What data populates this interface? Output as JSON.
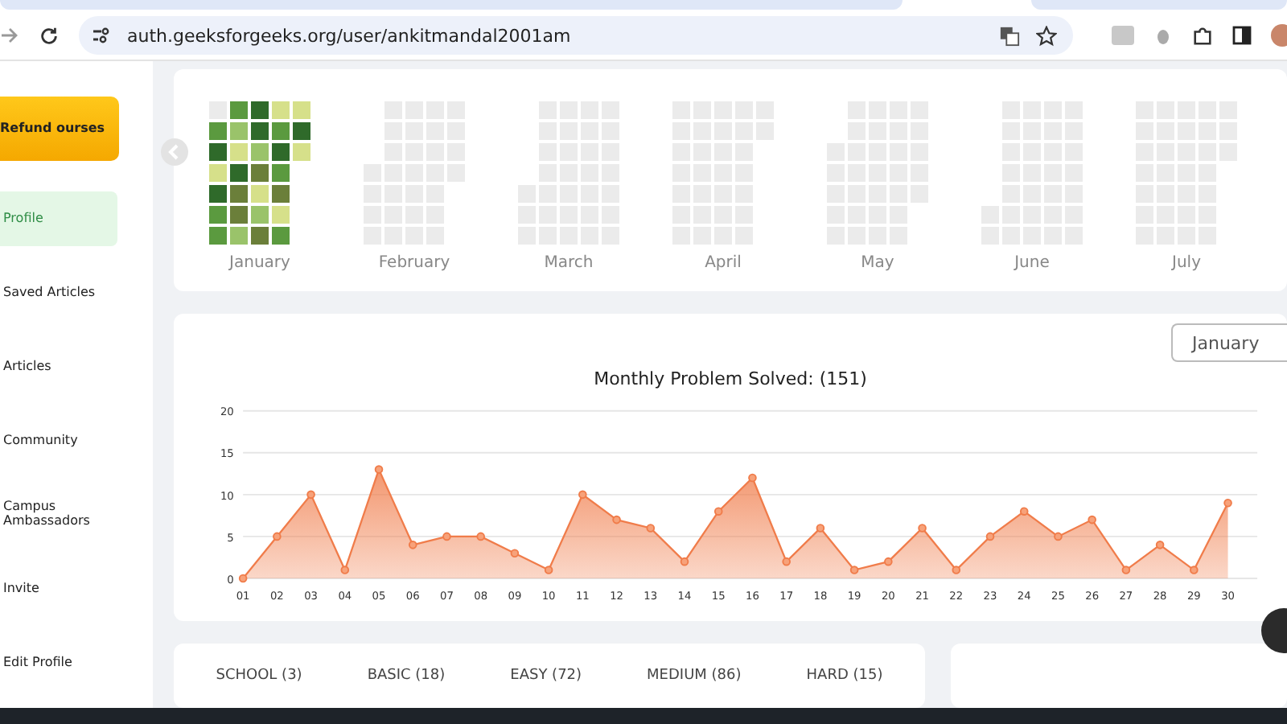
{
  "browser": {
    "url": "auth.geeksforgeeks.org/user/ankitmandal2001am"
  },
  "sidebar": {
    "promo": "Refund ourses",
    "items": [
      {
        "label": "Profile",
        "selected": true
      },
      {
        "label": "Saved Articles",
        "selected": false
      },
      {
        "label": "Articles",
        "selected": false
      },
      {
        "label": "Community",
        "selected": false
      },
      {
        "label": "Campus Ambassadors",
        "selected": false
      },
      {
        "label": "Invite",
        "selected": false
      },
      {
        "label": "Edit Profile",
        "selected": false
      }
    ]
  },
  "heatmap": {
    "months": [
      {
        "name": "January",
        "rows": [
          [
            {
              "color": "#ebebeb"
            },
            {
              "color": "#5b9a3f"
            },
            {
              "color": "#2f6a2a"
            },
            {
              "color": "#d6e08a"
            },
            {
              "color": "#d6e08a"
            }
          ],
          [
            {
              "color": "#5b9a3f"
            },
            {
              "color": "#9ac36a"
            },
            {
              "color": "#2f6a2a"
            },
            {
              "color": "#5b9a3f"
            },
            {
              "color": "#2f6a2a"
            }
          ],
          [
            {
              "color": "#2f6a2a"
            },
            {
              "color": "#d6e08a"
            },
            {
              "color": "#9ac36a"
            },
            {
              "color": "#2f6a2a"
            },
            {
              "color": "#d6e08a"
            }
          ],
          [
            {
              "color": "#d6e08a"
            },
            {
              "color": "#2f6a2a"
            },
            {
              "color": "#6b7f3a"
            },
            {
              "color": "#5b9a3f"
            },
            null
          ],
          [
            {
              "color": "#2f6a2a"
            },
            {
              "color": "#6b7f3a"
            },
            {
              "color": "#d6e08a"
            },
            {
              "color": "#6b7f3a"
            },
            null
          ],
          [
            {
              "color": "#5b9a3f"
            },
            {
              "color": "#6b7f3a"
            },
            {
              "color": "#9ac36a"
            },
            {
              "color": "#d6e08a"
            },
            null
          ],
          [
            {
              "color": "#5b9a3f"
            },
            {
              "color": "#9ac36a"
            },
            {
              "color": "#6b7f3a"
            },
            {
              "color": "#5b9a3f"
            },
            null
          ]
        ]
      },
      {
        "name": "February",
        "rows": [
          [
            null,
            {
              "color": "#ebebeb"
            },
            {
              "color": "#ebebeb"
            },
            {
              "color": "#ebebeb"
            },
            {
              "color": "#ebebeb"
            }
          ],
          [
            null,
            {
              "color": "#ebebeb"
            },
            {
              "color": "#ebebeb"
            },
            {
              "color": "#ebebeb"
            },
            {
              "color": "#ebebeb"
            }
          ],
          [
            null,
            {
              "color": "#ebebeb"
            },
            {
              "color": "#ebebeb"
            },
            {
              "color": "#ebebeb"
            },
            {
              "color": "#ebebeb"
            }
          ],
          [
            {
              "color": "#ebebeb"
            },
            {
              "color": "#ebebeb"
            },
            {
              "color": "#ebebeb"
            },
            {
              "color": "#ebebeb"
            },
            {
              "color": "#ebebeb"
            }
          ],
          [
            {
              "color": "#ebebeb"
            },
            {
              "color": "#ebebeb"
            },
            {
              "color": "#ebebeb"
            },
            {
              "color": "#ebebeb"
            },
            null
          ],
          [
            {
              "color": "#ebebeb"
            },
            {
              "color": "#ebebeb"
            },
            {
              "color": "#ebebeb"
            },
            {
              "color": "#ebebeb"
            },
            null
          ],
          [
            {
              "color": "#ebebeb"
            },
            {
              "color": "#ebebeb"
            },
            {
              "color": "#ebebeb"
            },
            {
              "color": "#ebebeb"
            },
            null
          ]
        ]
      },
      {
        "name": "March",
        "rows": [
          [
            null,
            {
              "color": "#ebebeb"
            },
            {
              "color": "#ebebeb"
            },
            {
              "color": "#ebebeb"
            },
            {
              "color": "#ebebeb"
            }
          ],
          [
            null,
            {
              "color": "#ebebeb"
            },
            {
              "color": "#ebebeb"
            },
            {
              "color": "#ebebeb"
            },
            {
              "color": "#ebebeb"
            }
          ],
          [
            null,
            {
              "color": "#ebebeb"
            },
            {
              "color": "#ebebeb"
            },
            {
              "color": "#ebebeb"
            },
            {
              "color": "#ebebeb"
            }
          ],
          [
            null,
            {
              "color": "#ebebeb"
            },
            {
              "color": "#ebebeb"
            },
            {
              "color": "#ebebeb"
            },
            {
              "color": "#ebebeb"
            }
          ],
          [
            {
              "color": "#ebebeb"
            },
            {
              "color": "#ebebeb"
            },
            {
              "color": "#ebebeb"
            },
            {
              "color": "#ebebeb"
            },
            {
              "color": "#ebebeb"
            }
          ],
          [
            {
              "color": "#ebebeb"
            },
            {
              "color": "#ebebeb"
            },
            {
              "color": "#ebebeb"
            },
            {
              "color": "#ebebeb"
            },
            {
              "color": "#ebebeb"
            }
          ],
          [
            {
              "color": "#ebebeb"
            },
            {
              "color": "#ebebeb"
            },
            {
              "color": "#ebebeb"
            },
            {
              "color": "#ebebeb"
            },
            {
              "color": "#ebebeb"
            }
          ]
        ]
      },
      {
        "name": "April",
        "rows": [
          [
            {
              "color": "#ebebeb"
            },
            {
              "color": "#ebebeb"
            },
            {
              "color": "#ebebeb"
            },
            {
              "color": "#ebebeb"
            },
            {
              "color": "#ebebeb"
            }
          ],
          [
            {
              "color": "#ebebeb"
            },
            {
              "color": "#ebebeb"
            },
            {
              "color": "#ebebeb"
            },
            {
              "color": "#ebebeb"
            },
            {
              "color": "#ebebeb"
            }
          ],
          [
            {
              "color": "#ebebeb"
            },
            {
              "color": "#ebebeb"
            },
            {
              "color": "#ebebeb"
            },
            {
              "color": "#ebebeb"
            },
            null
          ],
          [
            {
              "color": "#ebebeb"
            },
            {
              "color": "#ebebeb"
            },
            {
              "color": "#ebebeb"
            },
            {
              "color": "#ebebeb"
            },
            null
          ],
          [
            {
              "color": "#ebebeb"
            },
            {
              "color": "#ebebeb"
            },
            {
              "color": "#ebebeb"
            },
            {
              "color": "#ebebeb"
            },
            null
          ],
          [
            {
              "color": "#ebebeb"
            },
            {
              "color": "#ebebeb"
            },
            {
              "color": "#ebebeb"
            },
            {
              "color": "#ebebeb"
            },
            null
          ],
          [
            {
              "color": "#ebebeb"
            },
            {
              "color": "#ebebeb"
            },
            {
              "color": "#ebebeb"
            },
            {
              "color": "#ebebeb"
            },
            null
          ]
        ]
      },
      {
        "name": "May",
        "rows": [
          [
            null,
            {
              "color": "#ebebeb"
            },
            {
              "color": "#ebebeb"
            },
            {
              "color": "#ebebeb"
            },
            {
              "color": "#ebebeb"
            }
          ],
          [
            null,
            {
              "color": "#ebebeb"
            },
            {
              "color": "#ebebeb"
            },
            {
              "color": "#ebebeb"
            },
            {
              "color": "#ebebeb"
            }
          ],
          [
            {
              "color": "#ebebeb"
            },
            {
              "color": "#ebebeb"
            },
            {
              "color": "#ebebeb"
            },
            {
              "color": "#ebebeb"
            },
            {
              "color": "#ebebeb"
            }
          ],
          [
            {
              "color": "#ebebeb"
            },
            {
              "color": "#ebebeb"
            },
            {
              "color": "#ebebeb"
            },
            {
              "color": "#ebebeb"
            },
            {
              "color": "#ebebeb"
            }
          ],
          [
            {
              "color": "#ebebeb"
            },
            {
              "color": "#ebebeb"
            },
            {
              "color": "#ebebeb"
            },
            {
              "color": "#ebebeb"
            },
            {
              "color": "#ebebeb"
            }
          ],
          [
            {
              "color": "#ebebeb"
            },
            {
              "color": "#ebebeb"
            },
            {
              "color": "#ebebeb"
            },
            {
              "color": "#ebebeb"
            },
            null
          ],
          [
            {
              "color": "#ebebeb"
            },
            {
              "color": "#ebebeb"
            },
            {
              "color": "#ebebeb"
            },
            {
              "color": "#ebebeb"
            },
            null
          ]
        ]
      },
      {
        "name": "June",
        "rows": [
          [
            null,
            {
              "color": "#ebebeb"
            },
            {
              "color": "#ebebeb"
            },
            {
              "color": "#ebebeb"
            },
            {
              "color": "#ebebeb"
            }
          ],
          [
            null,
            {
              "color": "#ebebeb"
            },
            {
              "color": "#ebebeb"
            },
            {
              "color": "#ebebeb"
            },
            {
              "color": "#ebebeb"
            }
          ],
          [
            null,
            {
              "color": "#ebebeb"
            },
            {
              "color": "#ebebeb"
            },
            {
              "color": "#ebebeb"
            },
            {
              "color": "#ebebeb"
            }
          ],
          [
            null,
            {
              "color": "#ebebeb"
            },
            {
              "color": "#ebebeb"
            },
            {
              "color": "#ebebeb"
            },
            {
              "color": "#ebebeb"
            }
          ],
          [
            null,
            {
              "color": "#ebebeb"
            },
            {
              "color": "#ebebeb"
            },
            {
              "color": "#ebebeb"
            },
            {
              "color": "#ebebeb"
            }
          ],
          [
            {
              "color": "#ebebeb"
            },
            {
              "color": "#ebebeb"
            },
            {
              "color": "#ebebeb"
            },
            {
              "color": "#ebebeb"
            },
            {
              "color": "#ebebeb"
            }
          ],
          [
            {
              "color": "#ebebeb"
            },
            {
              "color": "#ebebeb"
            },
            {
              "color": "#ebebeb"
            },
            {
              "color": "#ebebeb"
            },
            {
              "color": "#ebebeb"
            }
          ]
        ]
      },
      {
        "name": "July",
        "rows": [
          [
            {
              "color": "#ebebeb"
            },
            {
              "color": "#ebebeb"
            },
            {
              "color": "#ebebeb"
            },
            {
              "color": "#ebebeb"
            },
            {
              "color": "#ebebeb"
            }
          ],
          [
            {
              "color": "#ebebeb"
            },
            {
              "color": "#ebebeb"
            },
            {
              "color": "#ebebeb"
            },
            {
              "color": "#ebebeb"
            },
            {
              "color": "#ebebeb"
            }
          ],
          [
            {
              "color": "#ebebeb"
            },
            {
              "color": "#ebebeb"
            },
            {
              "color": "#ebebeb"
            },
            {
              "color": "#ebebeb"
            },
            {
              "color": "#ebebeb"
            }
          ],
          [
            {
              "color": "#ebebeb"
            },
            {
              "color": "#ebebeb"
            },
            {
              "color": "#ebebeb"
            },
            {
              "color": "#ebebeb"
            },
            null
          ],
          [
            {
              "color": "#ebebeb"
            },
            {
              "color": "#ebebeb"
            },
            {
              "color": "#ebebeb"
            },
            {
              "color": "#ebebeb"
            },
            null
          ],
          [
            {
              "color": "#ebebeb"
            },
            {
              "color": "#ebebeb"
            },
            {
              "color": "#ebebeb"
            },
            {
              "color": "#ebebeb"
            },
            null
          ],
          [
            {
              "color": "#ebebeb"
            },
            {
              "color": "#ebebeb"
            },
            {
              "color": "#ebebeb"
            },
            {
              "color": "#ebebeb"
            },
            null
          ]
        ]
      }
    ]
  },
  "chart": {
    "dropdown": "January",
    "chart_data": {
      "type": "area",
      "title": "Monthly Problem Solved: (151)",
      "categories": [
        "01",
        "02",
        "03",
        "04",
        "05",
        "06",
        "07",
        "08",
        "09",
        "10",
        "11",
        "12",
        "13",
        "14",
        "15",
        "16",
        "17",
        "18",
        "19",
        "20",
        "21",
        "22",
        "23",
        "24",
        "25",
        "26",
        "27",
        "28",
        "29",
        "30"
      ],
      "series": [
        {
          "color": "#f07c4a",
          "values": [
            0,
            5,
            10,
            1,
            13,
            4,
            5,
            5,
            3,
            1,
            10,
            7,
            6,
            2,
            8,
            12,
            2,
            6,
            1,
            2,
            6,
            1,
            5,
            8,
            5,
            7,
            1,
            4,
            1,
            9
          ]
        }
      ],
      "ylim": [
        0,
        20
      ],
      "yticks": [
        0,
        5,
        10,
        15,
        20
      ],
      "grid": true
    }
  },
  "difficulty_tabs": [
    {
      "label": "SCHOOL (3)"
    },
    {
      "label": "BASIC (18)"
    },
    {
      "label": "EASY (72)"
    },
    {
      "label": "MEDIUM (86)"
    },
    {
      "label": "HARD (15)"
    }
  ]
}
